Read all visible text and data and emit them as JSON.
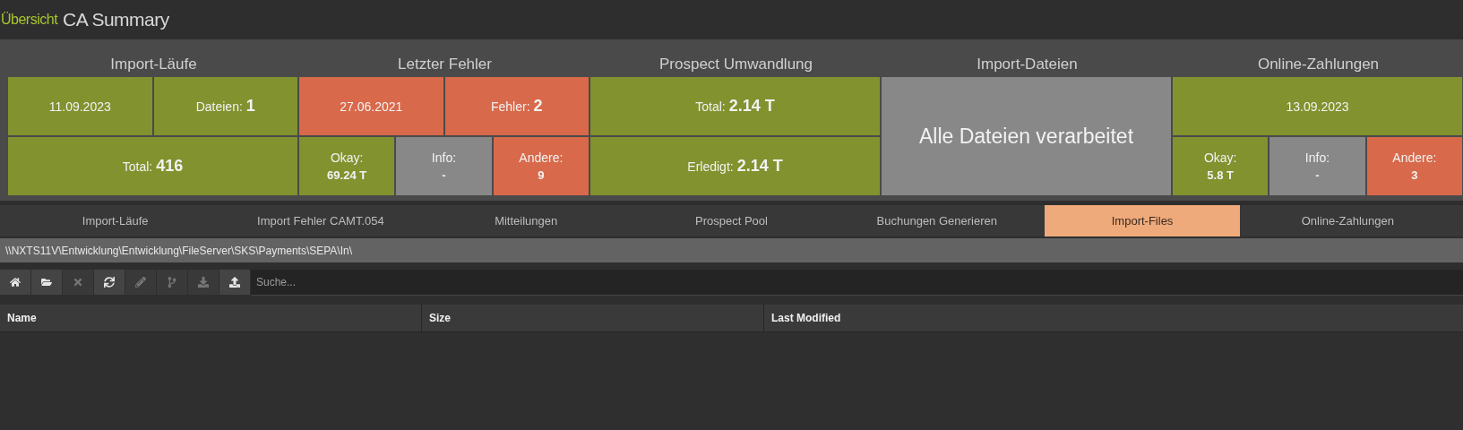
{
  "header": {
    "breadcrumb": "Übersicht",
    "title": "CA Summary"
  },
  "groups": [
    {
      "title": "Import-Läufe",
      "top": [
        {
          "kind": "inline",
          "color": "#82922f",
          "label": "11.09.2023"
        },
        {
          "kind": "inline",
          "color": "#82922f",
          "label": "Dateien:",
          "value": "1"
        }
      ],
      "bottom": [
        {
          "kind": "inline",
          "color": "#82922f",
          "label": "Total:",
          "value": "416"
        }
      ]
    },
    {
      "title": "Letzter Fehler",
      "top": [
        {
          "kind": "inline",
          "color": "#d8694b",
          "label": "27.06.2021"
        },
        {
          "kind": "inline",
          "color": "#d8694b",
          "label": "Fehler:",
          "value": "2"
        }
      ],
      "bottom": [
        {
          "kind": "stacked",
          "color": "#82922f",
          "label": "Okay:",
          "value": "69.24 T"
        },
        {
          "kind": "stacked",
          "color": "#888888",
          "label": "Info:",
          "value": "-"
        },
        {
          "kind": "stacked",
          "color": "#d8694b",
          "label": "Andere:",
          "value": "9"
        }
      ]
    },
    {
      "title": "Prospect Umwandlung",
      "top": [
        {
          "kind": "inline",
          "color": "#82922f",
          "label": "Total:",
          "value": "2.14 T"
        }
      ],
      "bottom": [
        {
          "kind": "inline",
          "color": "#82922f",
          "label": "Erledigt:",
          "value": "2.14 T"
        }
      ]
    },
    {
      "title": "Import-Dateien",
      "top": [
        {
          "kind": "large",
          "color": "#888888",
          "label": "Alle Dateien verarbeitet"
        }
      ]
    },
    {
      "title": "Online-Zahlungen",
      "top": [
        {
          "kind": "inline",
          "color": "#82922f",
          "label": "13.09.2023"
        }
      ],
      "bottom": [
        {
          "kind": "stacked",
          "color": "#82922f",
          "label": "Okay:",
          "value": "5.8 T"
        },
        {
          "kind": "stacked",
          "color": "#888888",
          "label": "Info:",
          "value": "-"
        },
        {
          "kind": "stacked",
          "color": "#d8694b",
          "label": "Andere:",
          "value": "3"
        }
      ]
    }
  ],
  "tabs": [
    {
      "label": "Import-Läufe",
      "selected": false
    },
    {
      "label": "Import Fehler CAMT.054",
      "selected": false
    },
    {
      "label": "Mitteilungen",
      "selected": false
    },
    {
      "label": "Prospect Pool",
      "selected": false
    },
    {
      "label": "Buchungen Generieren",
      "selected": false
    },
    {
      "label": "Import-Files",
      "selected": true
    },
    {
      "label": "Online-Zahlungen",
      "selected": false
    }
  ],
  "path": "\\\\NXTS11V\\Entwicklung\\Entwicklung\\FileServer\\SKS\\Payments\\SEPA\\In\\",
  "toolbar": [
    {
      "kind": "home",
      "disabled": false
    },
    {
      "kind": "open",
      "disabled": false
    },
    {
      "kind": "delete",
      "disabled": true
    },
    {
      "kind": "refresh",
      "disabled": false
    },
    {
      "kind": "edit",
      "disabled": true
    },
    {
      "kind": "branch",
      "disabled": true
    },
    {
      "kind": "download",
      "disabled": true
    },
    {
      "kind": "upload",
      "disabled": false
    }
  ],
  "search": {
    "placeholder": "Suche..."
  },
  "table": {
    "columns": [
      "Name",
      "Size",
      "Last Modified"
    ]
  }
}
